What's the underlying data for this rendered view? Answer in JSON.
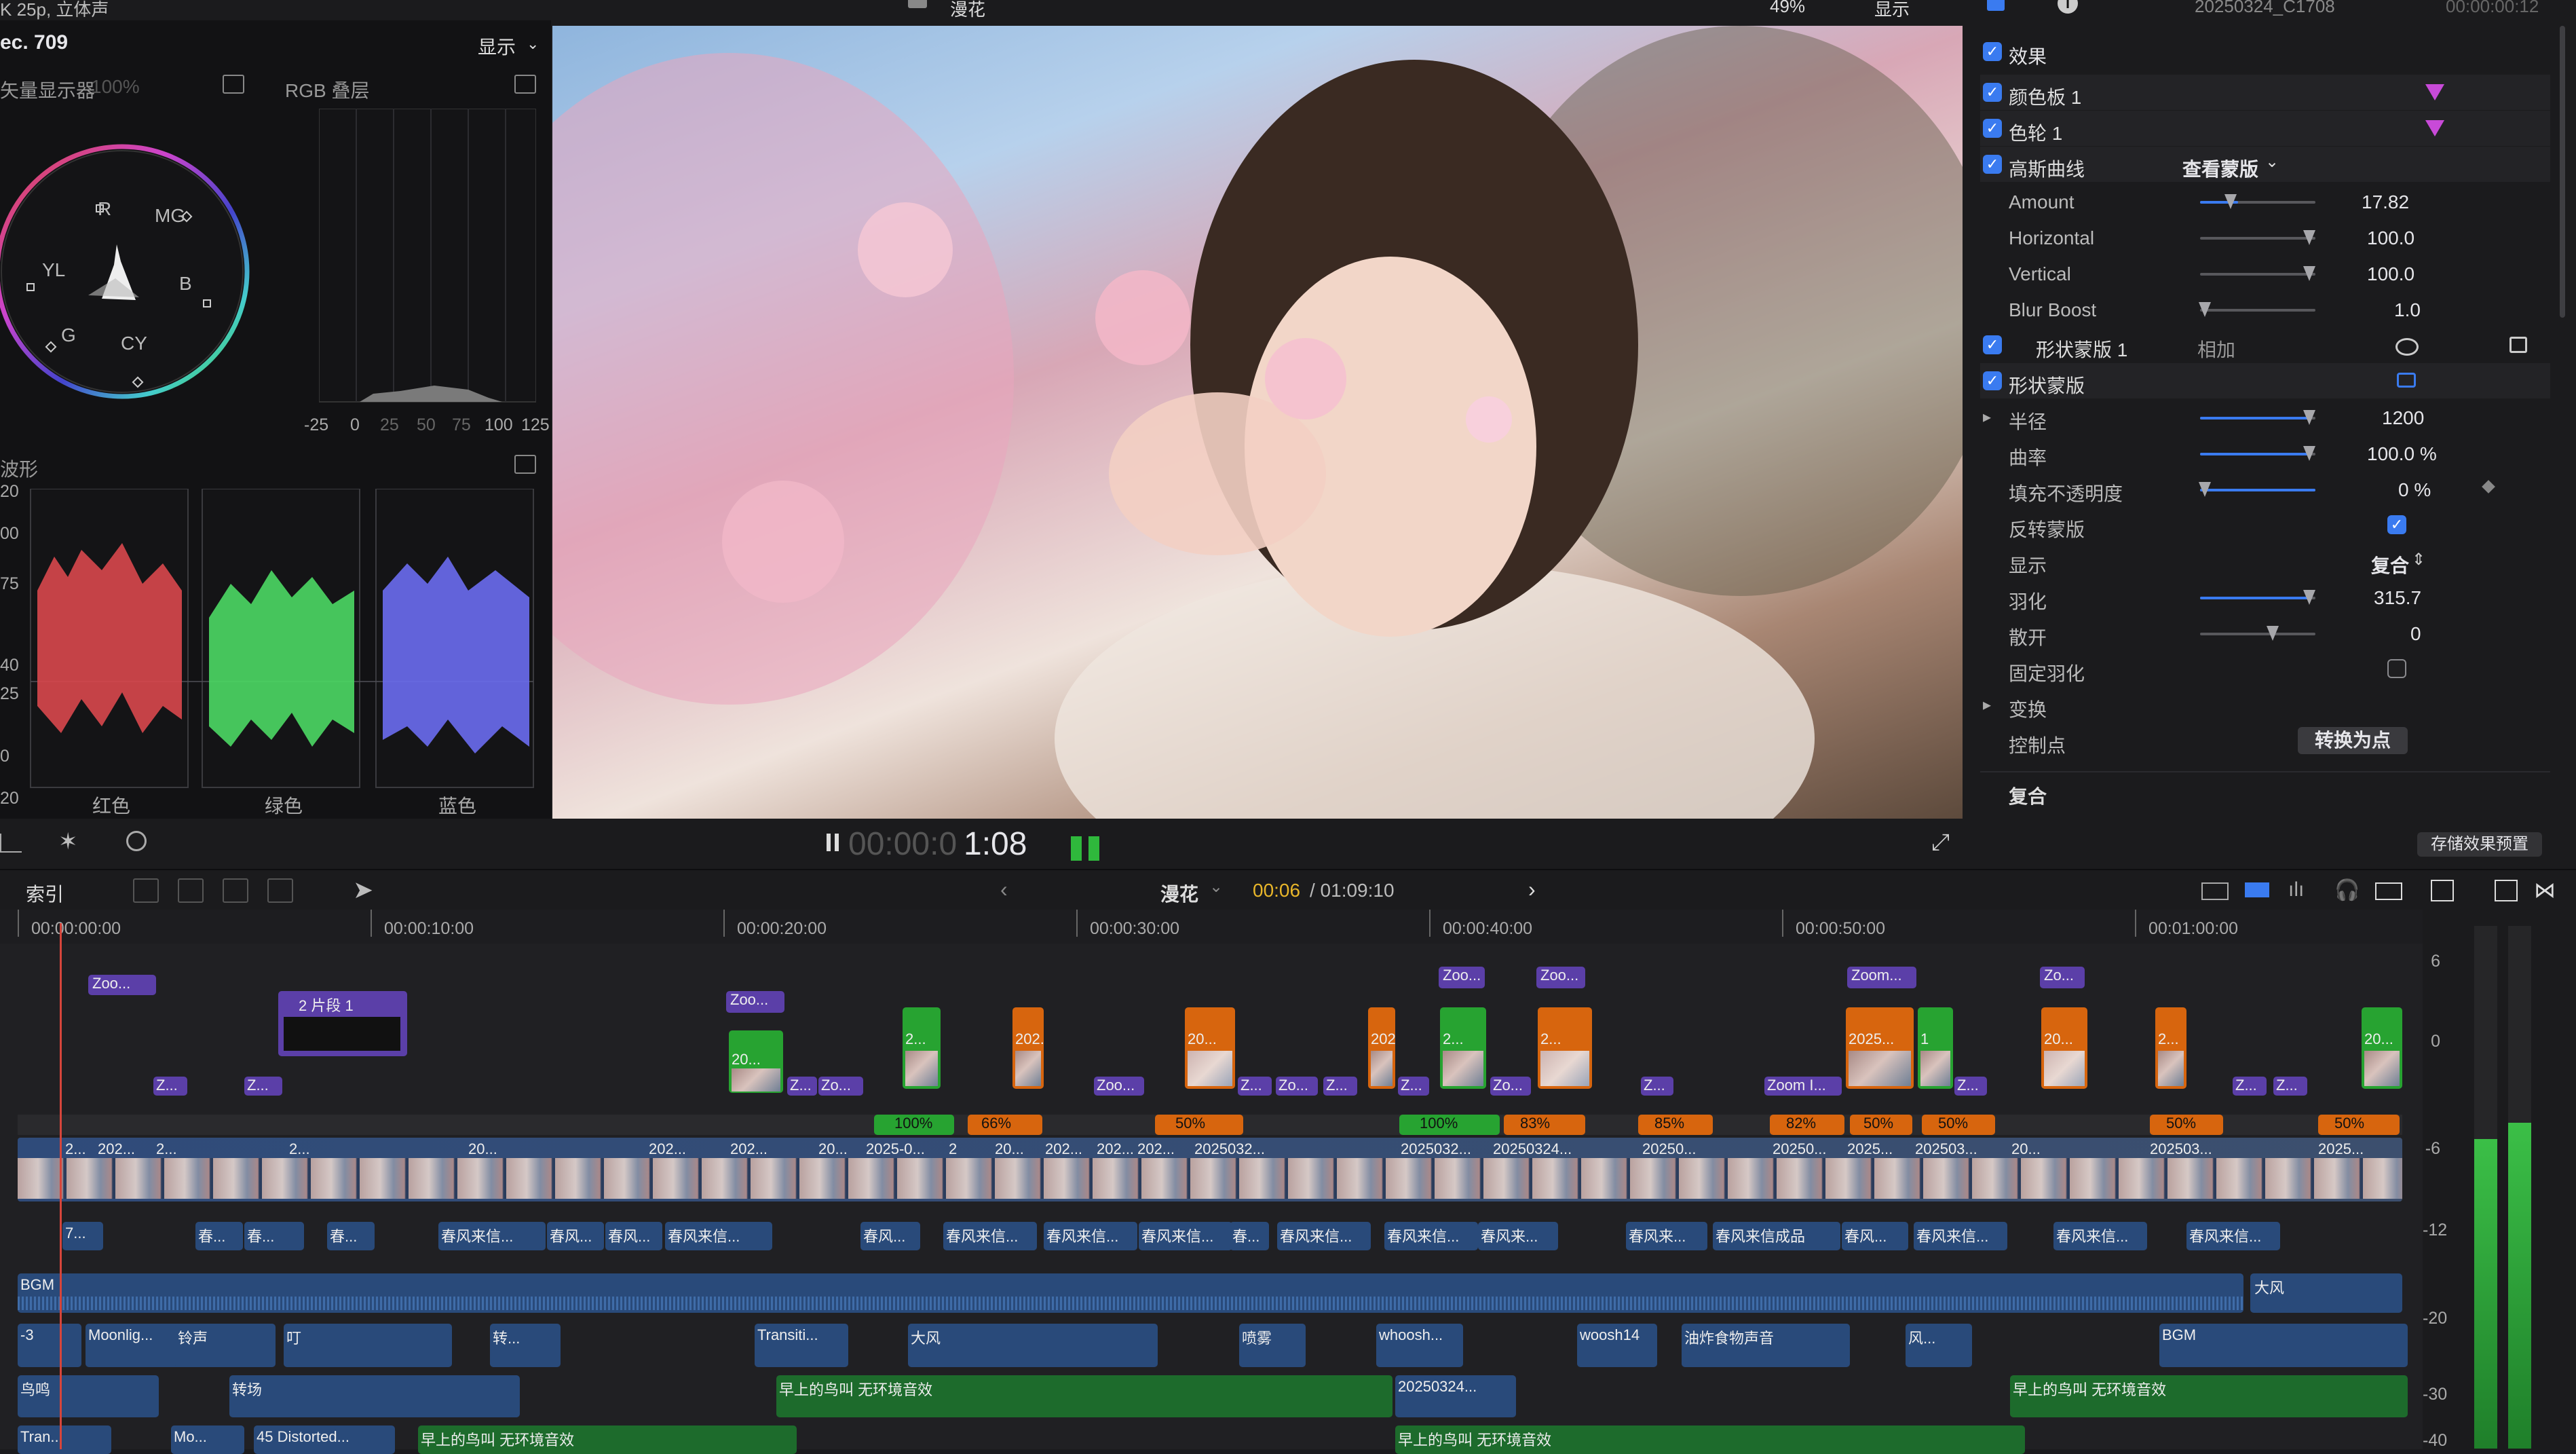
{
  "top": {
    "format_text": "K 25p, 立体声",
    "viewer_title": "漫花",
    "zoom": "49%",
    "display_label": "显示",
    "inspector_clip": "20250324_C1708",
    "inspector_time": "00:00:00:12"
  },
  "scopes": {
    "title": "ec. 709",
    "display": "显示",
    "vectorscope_label": "矢量显示器",
    "vectorscope_pct": "100%",
    "rgb_label": "RGB 叠层",
    "rgb_axis": [
      "-25",
      "0",
      "25",
      "50",
      "75",
      "100",
      "125"
    ],
    "vector_labels": [
      "R",
      "MG",
      "YL",
      "B",
      "G",
      "CY"
    ],
    "waveform_label": "波形",
    "waveform_axis": [
      "20",
      "00",
      "75",
      "40",
      "25",
      "0",
      "20"
    ],
    "waveform_channels": [
      "红色",
      "绿色",
      "蓝色"
    ]
  },
  "viewer": {
    "timecode_dim": "00:00:0",
    "timecode": "1:08"
  },
  "inspector": {
    "effects_label": "效果",
    "rows": [
      {
        "label": "颜色板 1"
      },
      {
        "label": "色轮 1"
      },
      {
        "label": "高斯曲线",
        "extra": "查看蒙版"
      }
    ],
    "params": [
      {
        "label": "Amount",
        "value": "17.82"
      },
      {
        "label": "Horizontal",
        "value": "100.0"
      },
      {
        "label": "Vertical",
        "value": "100.0"
      },
      {
        "label": "Blur Boost",
        "value": "1.0"
      }
    ],
    "shape_mask1": "形状蒙版 1",
    "blend_mode": "相加",
    "shape_mask": "形状蒙版",
    "mask_params": [
      {
        "label": "半径",
        "value": "1200"
      },
      {
        "label": "曲率",
        "value": "100.0 %"
      },
      {
        "label": "填充不透明度",
        "value": "0 %"
      },
      {
        "label": "反转蒙版",
        "value": ""
      },
      {
        "label": "显示",
        "value": "复合"
      },
      {
        "label": "羽化",
        "value": "315.7"
      },
      {
        "label": "散开",
        "value": "0"
      },
      {
        "label": "固定羽化",
        "value": ""
      }
    ],
    "transform": "变换",
    "control_points": "控制点",
    "convert_button": "转换为点",
    "composite": "复合",
    "save_preset": "存储效果预置"
  },
  "timeline": {
    "index_label": "索引",
    "project": "漫花",
    "position": "00:06",
    "duration": "/ 01:09:10",
    "ruler": [
      "00:00:00:00",
      "00:00:10:00",
      "00:00:20:00",
      "00:00:30:00",
      "00:00:40:00",
      "00:00:50:00",
      "00:01:00:00"
    ],
    "meter_scale": [
      "6",
      "0",
      "-6",
      "-12",
      "-20",
      "-30",
      "-40"
    ],
    "upper_labels": [
      "Zoo...",
      "2 片段 1",
      "Zoo...",
      "20...",
      "2...",
      "202...",
      "20...",
      "202...",
      "2...",
      "Zoo...",
      "Zoo...",
      "Zoom...",
      "2...",
      "Zo...",
      "2025...",
      "1",
      "20...",
      "2...",
      "20..."
    ],
    "small_labels": [
      "Z...",
      "Z...",
      "Z...",
      "Zo...",
      "Zoo...",
      "Z...",
      "Zo...",
      "Z...",
      "Z...",
      "Zo...",
      "Z...",
      "Zoom I...",
      "Z...",
      "Z...",
      "Z..."
    ],
    "speed_labels": [
      "100%",
      "66%",
      "50%",
      "100%",
      "83%",
      "85%",
      "82%",
      "50%",
      "50%",
      "50%",
      "50%"
    ],
    "primary_labels": [
      "2...",
      "202...",
      "2...",
      "2...",
      "20...",
      "202...",
      "202...",
      "20...",
      "202...",
      "202...",
      "2025-0...",
      "2",
      "20...",
      "202...",
      "2025032...",
      "2025032...",
      "20250324...",
      "20250...",
      "20250...",
      "2025...",
      "202503...",
      "20...",
      "202503...",
      "2025..."
    ],
    "text_labels": [
      "7...",
      "春...",
      "春...",
      "春...",
      "春风来信...",
      "春风...",
      "春风...",
      "春风来信...",
      "春风...",
      "春风来信...",
      "春风来信...",
      "春风来信...",
      "春...",
      "春风来信...",
      "春风来信...",
      "春风来...",
      "春风来...",
      "春风来信成品",
      "春风...",
      "春风来信...",
      "春风来信...",
      "春风来信..."
    ],
    "bgm_label": "BGM",
    "wind_label": "大风",
    "audio1": [
      "-3",
      "Moonlig...",
      "铃声",
      "叮",
      "转...",
      "Transiti...",
      "大风",
      "喷雾",
      "whoosh...",
      "woosh14",
      "油炸食物声音",
      "风...",
      "BGM"
    ],
    "audio2": [
      "鸟鸣",
      "转场",
      "早上的鸟叫 无环境音效",
      "20250324...",
      "早上的鸟叫 无环境音效"
    ],
    "audio3": [
      "Tran...",
      "Mo...",
      "45 Distorted...",
      "早上的鸟叫 无环境音效",
      "早上的鸟叫 无环境音效"
    ]
  }
}
